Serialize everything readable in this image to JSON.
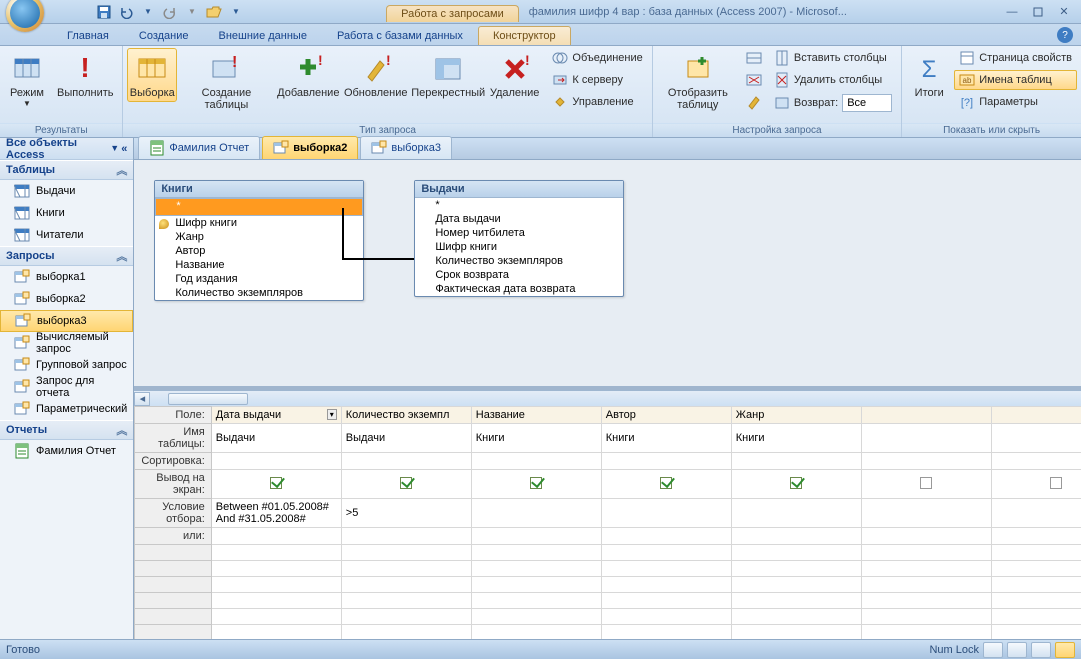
{
  "title": {
    "context_tab": "Работа с запросами",
    "document": "фамилия шифр 4 вар : база данных (Access 2007) - Microsof..."
  },
  "ribbon_tabs": [
    "Главная",
    "Создание",
    "Внешние данные",
    "Работа с базами данных",
    "Конструктор"
  ],
  "ribbon": {
    "g1_label": "Результаты",
    "g1_mode": "Режим",
    "g1_run": "Выполнить",
    "g2_label": "Тип запроса",
    "g2_select": "Выборка",
    "g2_maketable": "Создание таблицы",
    "g2_append": "Добавление",
    "g2_update": "Обновление",
    "g2_crosstab": "Перекрестный",
    "g2_delete": "Удаление",
    "g3_join": "Объединение",
    "g3_server": "К серверу",
    "g3_mgmt": "Управление",
    "g4_label": "Настройка запроса",
    "g4_show": "Отобразить таблицу",
    "g4_ins": "Вставить столбцы",
    "g4_del": "Удалить столбцы",
    "g4_ret": "Возврат:",
    "g4_ret_val": "Все",
    "g5_label": "Показать или скрыть",
    "g5_totals": "Итоги",
    "g5_prop": "Страница свойств",
    "g5_names": "Имена таблиц",
    "g5_params": "Параметры"
  },
  "nav": {
    "header": "Все объекты Access",
    "grp_tables": "Таблицы",
    "tables": [
      "Выдачи",
      "Книги",
      "Читатели"
    ],
    "grp_queries": "Запросы",
    "queries": [
      "выборка1",
      "выборка2",
      "выборка3",
      "Вычисляемый запрос",
      "Групповой запрос",
      "Запрос для отчета",
      "Параметрический"
    ],
    "grp_reports": "Отчеты",
    "reports": [
      "Фамилия Отчет"
    ]
  },
  "doc_tabs": [
    {
      "label": "Фамилия Отчет",
      "type": "report"
    },
    {
      "label": "выборка2",
      "type": "query",
      "active": true
    },
    {
      "label": "выборка3",
      "type": "query"
    }
  ],
  "tables_view": {
    "t1": {
      "title": "Книги",
      "fields": [
        "*",
        "Шифр книги",
        "Жанр",
        "Автор",
        "Название",
        "Год издания",
        "Количество экземпляров"
      ],
      "key": 1,
      "sel": 0
    },
    "t2": {
      "title": "Выдачи",
      "fields": [
        "*",
        "Дата выдачи",
        "Номер читбилета",
        "Шифр книги",
        "Количество экземпляров",
        "Срок возврата",
        "Фактическая дата возврата"
      ]
    }
  },
  "qbe": {
    "row_labels": [
      "Поле:",
      "Имя таблицы:",
      "Сортировка:",
      "Вывод на экран:",
      "Условие отбора:",
      "или:"
    ],
    "cols": [
      {
        "field": "Дата выдачи",
        "table": "Выдачи",
        "show": true,
        "crit": "Between #01.05.2008# And #31.05.2008#"
      },
      {
        "field": "Количество экземпл",
        "table": "Выдачи",
        "show": true,
        "crit": ">5"
      },
      {
        "field": "Название",
        "table": "Книги",
        "show": true,
        "crit": ""
      },
      {
        "field": "Автор",
        "table": "Книги",
        "show": true,
        "crit": ""
      },
      {
        "field": "Жанр",
        "table": "Книги",
        "show": true,
        "crit": ""
      }
    ]
  },
  "status": {
    "ready": "Готово",
    "numlock": "Num Lock"
  }
}
